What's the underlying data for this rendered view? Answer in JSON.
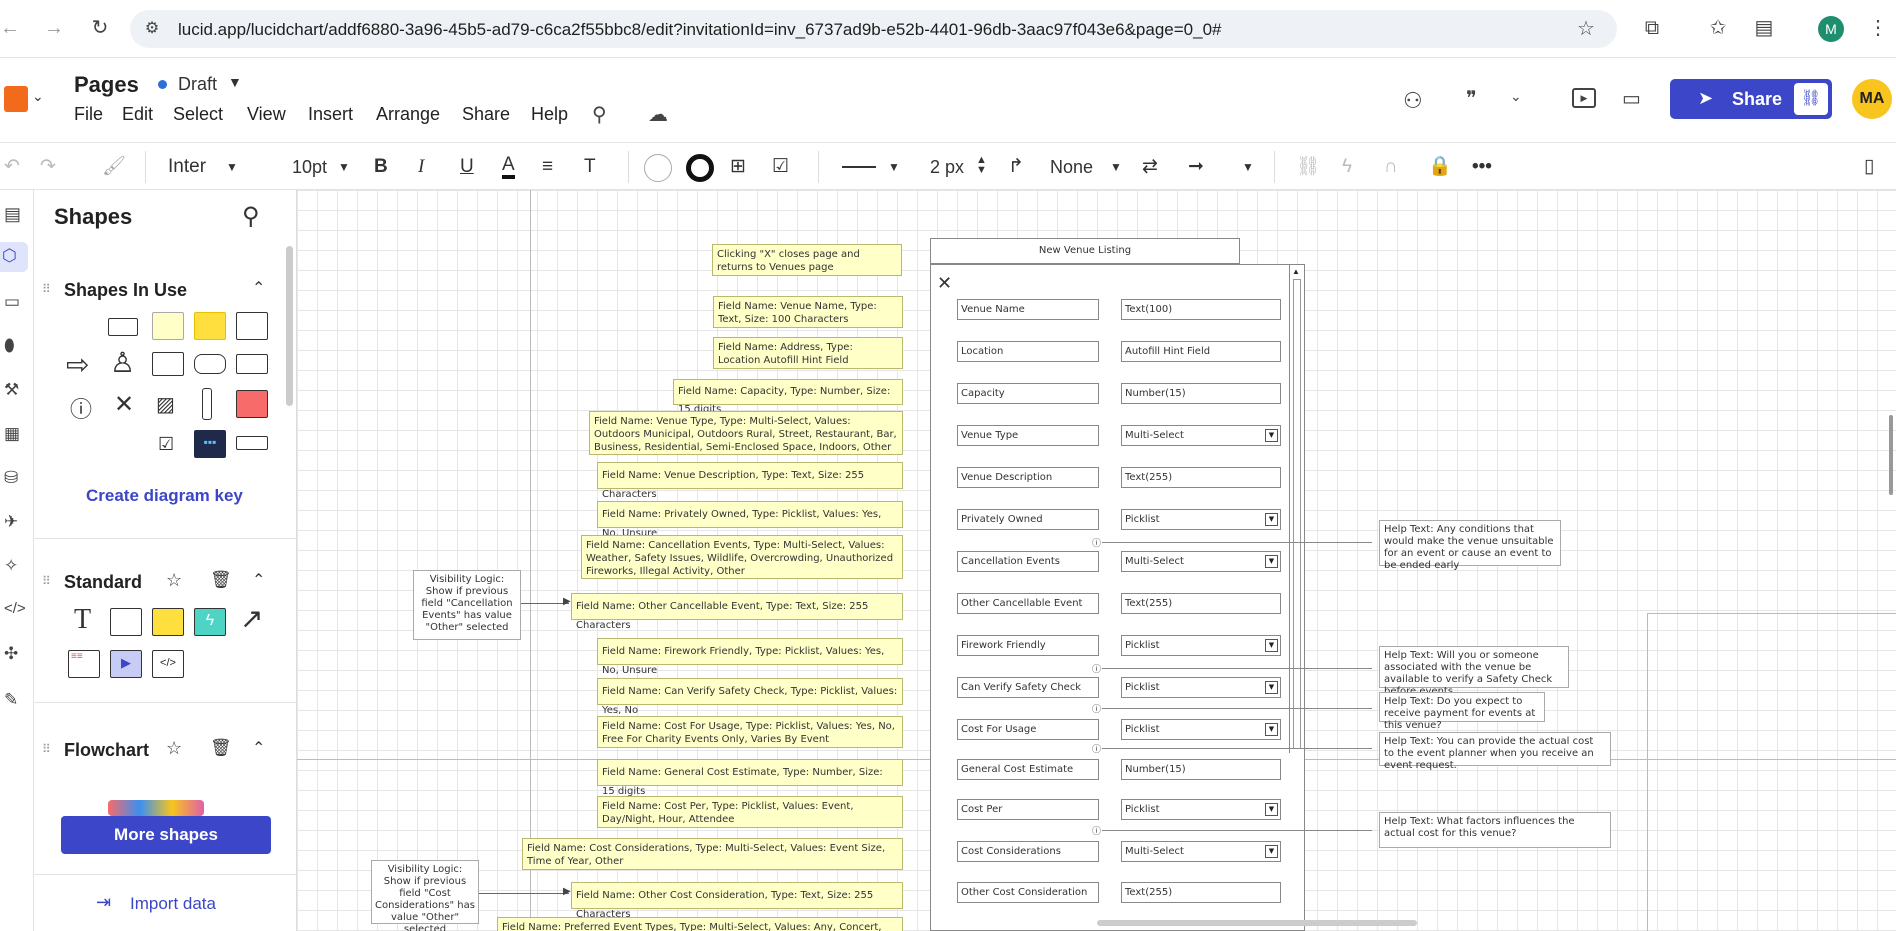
{
  "browser": {
    "url": "lucid.app/lucidchart/addf6880-3a96-45b5-ad79-c6ca2f55bbc8/edit?invitationId=inv_6737ad9b-e52b-4401-96db-3aac97f043e6&page=0_0#",
    "profile_initial": "M"
  },
  "app": {
    "doc_title": "Pages",
    "status": "Draft",
    "menu": [
      "File",
      "Edit",
      "Select",
      "View",
      "Insert",
      "Arrange",
      "Share",
      "Help"
    ],
    "share_label": "Share",
    "avatar": "MA"
  },
  "toolbar": {
    "font": "Inter",
    "font_size": "10pt",
    "bold": "B",
    "italic": "I",
    "underline": "U",
    "color": "A",
    "line_width": "2 px",
    "arrow_none": "None"
  },
  "panel": {
    "title": "Shapes",
    "shapes_in_use": "Shapes In Use",
    "create_key": "Create diagram key",
    "standard": "Standard",
    "flowchart": "Flowchart",
    "more_shapes": "More shapes",
    "import_data": "Import data"
  },
  "diagram": {
    "form_title": "New Venue Listing",
    "close_note": "Clicking \"X\" closes page and returns to Venues page",
    "fields": [
      {
        "label": "Venue Name",
        "value": "Text(100)",
        "dropdown": false,
        "note": "Field Name: Venue Name, Type: Text, Size: 100 Characters"
      },
      {
        "label": "Location",
        "value": "Autofill Hint Field",
        "dropdown": false,
        "note": "Field Name: Address, Type: Location Autofill Hint Field"
      },
      {
        "label": "Capacity",
        "value": "Number(15)",
        "dropdown": false,
        "note": "Field Name: Capacity, Type: Number, Size: 15 digits"
      },
      {
        "label": "Venue Type",
        "value": "Multi-Select",
        "dropdown": true,
        "note": "Field Name: Venue Type, Type: Multi-Select, Values: Outdoors Municipal, Outdoors Rural, Street, Restaurant, Bar, Business, Residential, Semi-Enclosed Space, Indoors, Other"
      },
      {
        "label": "Venue Description",
        "value": "Text(255)",
        "dropdown": false,
        "note": "Field Name: Venue Description, Type: Text, Size: 255 Characters"
      },
      {
        "label": "Privately Owned",
        "value": "Picklist",
        "dropdown": true,
        "note": "Field Name: Privately Owned, Type: Picklist, Values: Yes, No, Unsure"
      },
      {
        "label": "Cancellation Events",
        "value": "Multi-Select",
        "dropdown": true,
        "note": "Field Name: Cancellation Events, Type: Multi-Select, Values: Weather, Safety Issues, Wildlife, Overcrowding, Unauthorized Fireworks, Illegal Activity, Other"
      },
      {
        "label": "Other Cancellable Event",
        "value": "Text(255)",
        "dropdown": false,
        "note": "Field Name: Other Cancellable Event, Type: Text, Size: 255 Characters"
      },
      {
        "label": "Firework Friendly",
        "value": "Picklist",
        "dropdown": true,
        "note": "Field Name: Firework Friendly, Type: Picklist, Values: Yes, No, Unsure"
      },
      {
        "label": "Can Verify Safety Check",
        "value": "Picklist",
        "dropdown": true,
        "note": "Field Name: Can Verify Safety Check, Type: Picklist, Values: Yes, No"
      },
      {
        "label": "Cost For Usage",
        "value": "Picklist",
        "dropdown": true,
        "note": "Field Name: Cost For Usage, Type: Picklist, Values: Yes, No, Free For Charity Events Only, Varies By Event"
      },
      {
        "label": "General Cost Estimate",
        "value": "Number(15)",
        "dropdown": false,
        "note": "Field Name: General Cost Estimate, Type: Number, Size: 15 digits"
      },
      {
        "label": "Cost Per",
        "value": "Picklist",
        "dropdown": true,
        "note": "Field Name: Cost Per, Type: Picklist, Values: Event, Day/Night, Hour, Attendee"
      },
      {
        "label": "Cost Considerations",
        "value": "Multi-Select",
        "dropdown": true,
        "note": "Field Name: Cost Considerations, Type: Multi-Select, Values: Event Size, Time of Year, Other"
      },
      {
        "label": "Other Cost Consideration",
        "value": "Text(255)",
        "dropdown": false,
        "note": "Field Name: Other Cost Consideration, Type: Text, Size: 255 Characters"
      }
    ],
    "last_note": "Field Name: Preferred Event Types, Type: Multi-Select, Values: Any, Concert, Community",
    "visibility": [
      "Visibility Logic: Show if previous field \"Cancellation Events\" has value \"Other\" selected",
      "Visibility Logic: Show if previous field \"Cost Considerations\" has value \"Other\" selected"
    ],
    "help": [
      "Help Text: Any conditions that would make the venue unsuitable for an event or cause an event to be ended early",
      "Help Text: Will you or someone associated with the venue be available to verify a Safety Check before events",
      "Help Text: Do you expect to receive payment for events at this venue?",
      "Help Text: You can provide the actual cost to the event planner when you receive an event request.",
      "Help Text: What factors influences the actual cost for this venue?"
    ]
  }
}
